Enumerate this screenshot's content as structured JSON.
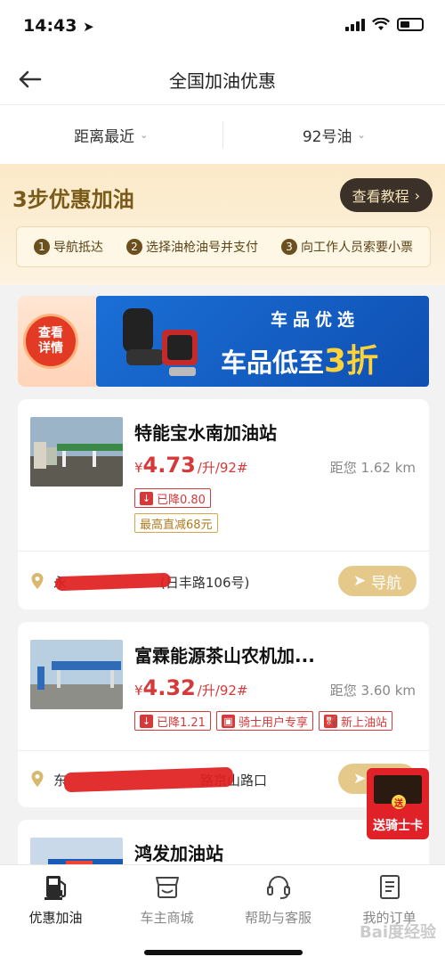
{
  "status_bar": {
    "time": "14:43"
  },
  "header": {
    "title": "全国加油优惠"
  },
  "filters": {
    "sort": "距离最近",
    "fuel": "92号油"
  },
  "promo": {
    "title": "3步优惠加油",
    "tutorial_button": "查看教程",
    "steps": [
      {
        "num": "1",
        "label": "导航抵达"
      },
      {
        "num": "2",
        "label": "选择油枪油号并支付"
      },
      {
        "num": "3",
        "label": "向工作人员索要小票"
      }
    ]
  },
  "ad": {
    "detail_button": "查看详情",
    "subtitle": "车品优选",
    "main_prefix": "车品低至",
    "main_highlight": "3折"
  },
  "stations": [
    {
      "name": "特能宝水南加油站",
      "currency": "¥",
      "price": "4.73",
      "unit": "/升/92#",
      "distance": "距您 1.62 km",
      "tag_drop": "已降0.80",
      "tag_discount": "最高直减68元",
      "address": "永　　　　　　　(日丰路106号)",
      "nav_button": "导航"
    },
    {
      "name": "富霖能源茶山农机加...",
      "currency": "¥",
      "price": "4.32",
      "unit": "/升/92#",
      "distance": "距您 3.60 km",
      "tag_drop": "已降1.21",
      "tag_rider": "骑士用户专享",
      "tag_new": "新上油站",
      "address": "东　　　　　　　　　　路京山路口",
      "nav_button": "导航"
    },
    {
      "name": "鸿发加油站"
    }
  ],
  "float_card": {
    "label": "送骑士卡",
    "seal": "送"
  },
  "tabs": [
    {
      "label": "优惠加油",
      "icon": "fuel-pump-icon"
    },
    {
      "label": "车主商城",
      "icon": "shop-icon"
    },
    {
      "label": "帮助与客服",
      "icon": "headset-icon"
    },
    {
      "label": "我的订单",
      "icon": "order-list-icon"
    }
  ],
  "watermark": "Bai度经验",
  "colors": {
    "price_red": "#d6393a",
    "gold": "#e5c98b",
    "dark_button": "#3b3128"
  }
}
